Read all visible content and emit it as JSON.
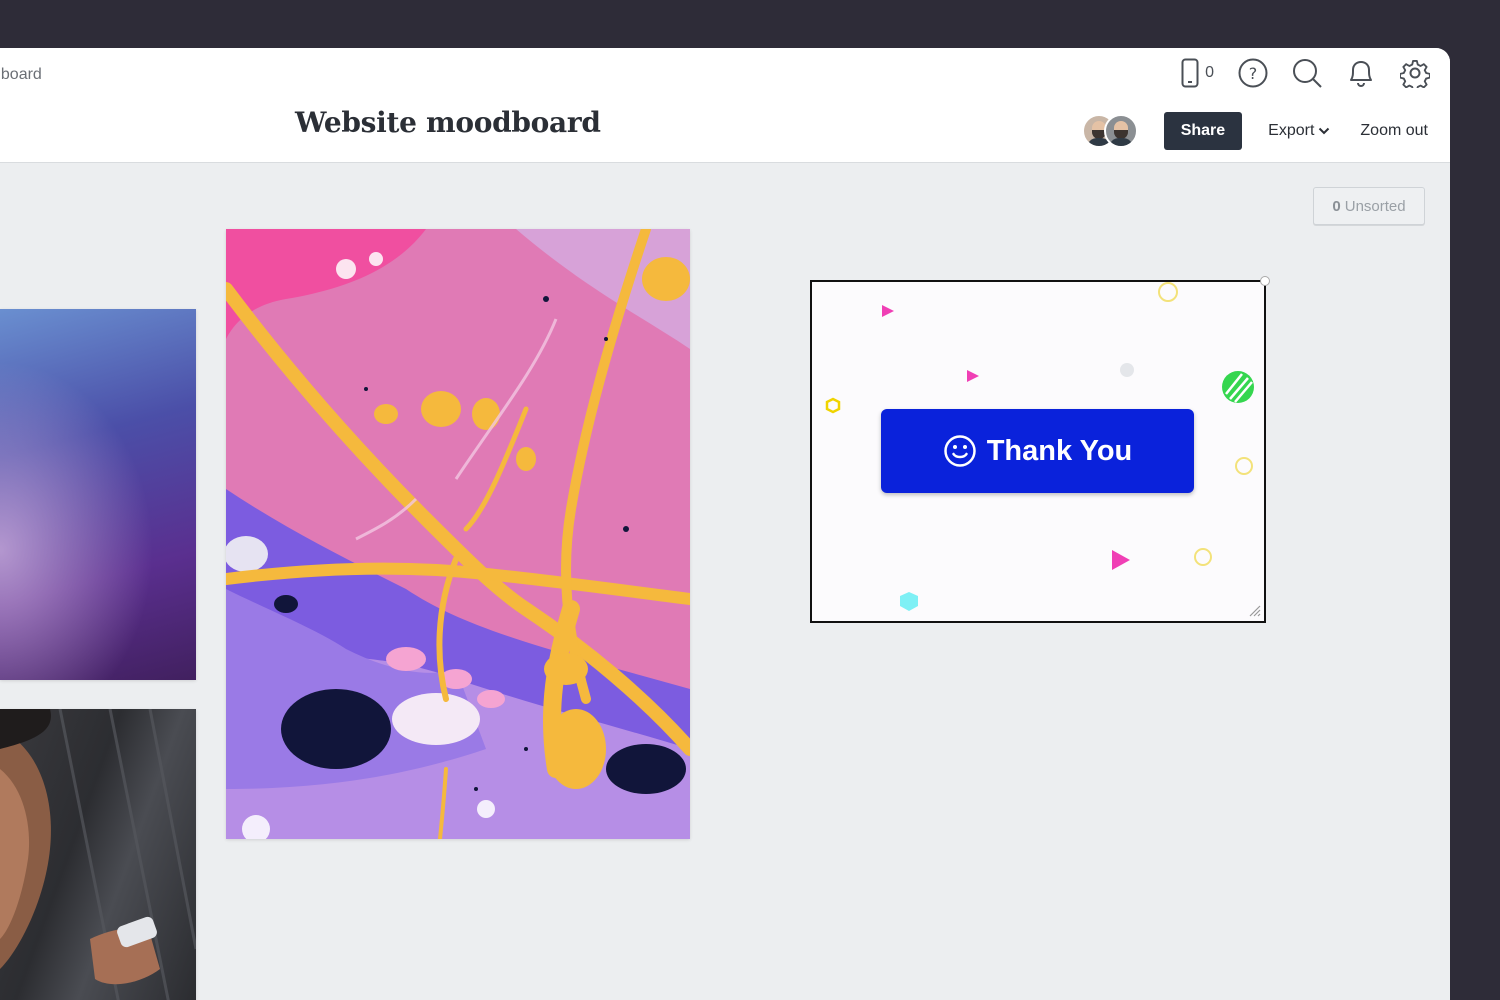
{
  "header": {
    "breadcrumb": "dboard",
    "title": "Website moodboard",
    "device_count": "0",
    "icons": [
      "phone-icon",
      "help-icon",
      "search-icon",
      "bell-icon",
      "gear-icon"
    ]
  },
  "actions": {
    "share_label": "Share",
    "export_label": "Export",
    "zoom_label": "Zoom out"
  },
  "unsorted": {
    "count": "0",
    "label": "Unsorted"
  },
  "thank_you": {
    "button_label": "Thank You",
    "button_color": "#0a22db"
  },
  "colors": {
    "background": "#eceef0",
    "share_bg": "#2b3340",
    "frame": "#2e2c38"
  }
}
